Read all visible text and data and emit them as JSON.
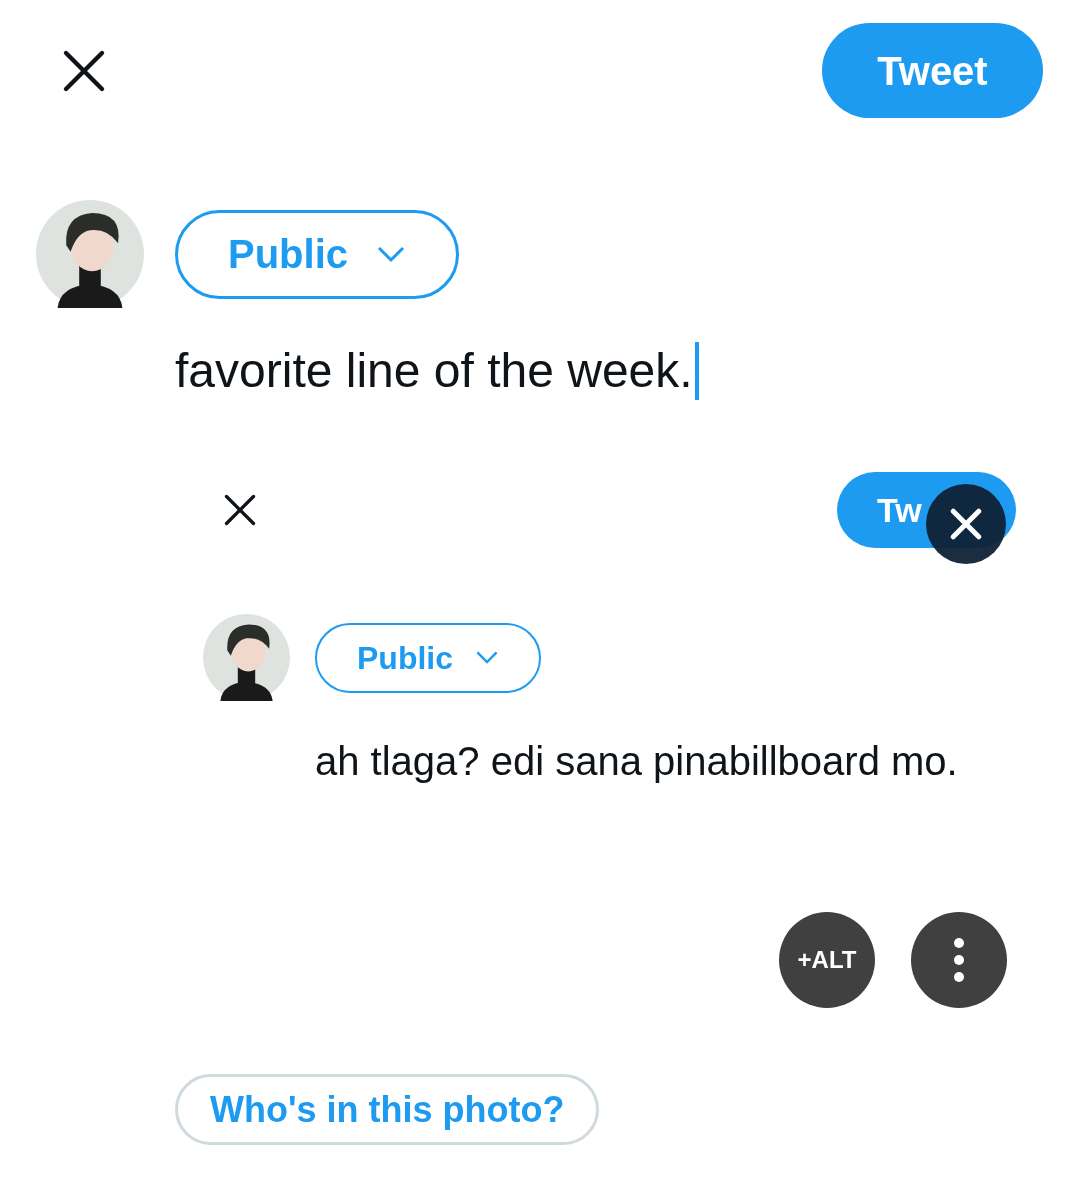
{
  "header": {
    "tweet_button": "Tweet"
  },
  "audience": "Public",
  "tweet_text": "favorite line of the week.",
  "attached_image": {
    "header": {
      "tweet_button": "Tw"
    },
    "audience": "Public",
    "tweet_text": "ah tlaga? edi sana pinabillboard mo."
  },
  "image_actions": {
    "alt_button": "+ALT"
  },
  "tag_people": "Who's in this photo?"
}
